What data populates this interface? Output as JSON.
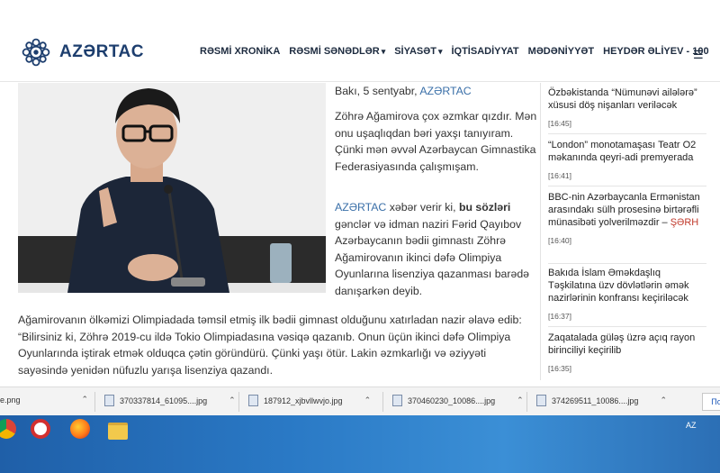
{
  "header": {
    "logo_text": "AZƏRTAC",
    "nav": [
      {
        "label": "RƏSMİ XRONİKA",
        "dropdown": false
      },
      {
        "label": "RƏSMİ SƏNƏDLƏR",
        "dropdown": true
      },
      {
        "label": "SİYASƏT",
        "dropdown": true
      },
      {
        "label": "İQTİSADİYYAT",
        "dropdown": false
      },
      {
        "label": "MƏDƏNİYYƏT",
        "dropdown": false
      },
      {
        "label": "HEYDƏR ƏLİYEV - 100",
        "dropdown": false
      }
    ],
    "menu_icon": "hamburger-icon"
  },
  "article": {
    "dateline_prefix": "Bakı, 5 sentyabr,",
    "dateline_brand": "AZƏRTAC",
    "p1": "Zöhrə Ağamirova çox əzmkar qızdır. Mən onu uşaqlıqdan bəri yaxşı tanıyıram. Çünki mən əvvəl Azərbaycan Gimnastika Federasiyasında çalışmışam.",
    "p2_brand": "AZƏRTAC",
    "p2_mid": " xəbər verir ki, ",
    "p2_bold": "bu sözləri",
    "p2_rest": " gənclər və idman naziri Fərid Qayıbov Azərbaycanın bədii gimnastı Zöhrə Ağamirovanın ikinci dəfə Olimpiya Oyunlarına lisenziya qazanması barədə danışarkən deyib.",
    "p3": "Ağamirovanın ölkəmizi Olimpiadada təmsil etmiş ilk bədii gimnast olduğunu xatırladan nazir əlavə edib: “Bilirsiniz ki, Zöhrə 2019-cu ildə Tokio Olimpiadasına vəsiqə qazanıb. Onun üçün ikinci dəfə Olimpiya Oyunlarında iştirak etmək olduqca çətin göründürü. Çünki yaşı ötür. Lakin əzmkarlığı və əziyyəti sayəsində yenidən nüfuzlu yarışa lisenziya qazandı."
  },
  "sidebar": {
    "items": [
      {
        "title": "Özbəkistanda “Nümunəvi ailələrə” xüsusi döş nişanları veriləcək",
        "time": "[16:45]"
      },
      {
        "title": "“London” monotamaşası Teatr O2 məkanında qeyri-adi premyerada",
        "time": "[16:41]"
      },
      {
        "title": "BBC-nin Azərbaycanla Ermənistan arasındakı sülh prosesinə birtərəfli münasibəti yolverilməzdir – ",
        "highlight": "ŞƏRH",
        "time": "[16:40]"
      },
      {
        "title": "Bakıda İslam Əməkdaşlıq Təşkilatına üzv dövlətlərin əmək nazirlərinin konfransı keçiriləcək",
        "time": "[16:37]"
      },
      {
        "title": "Zaqatalada güləş üzrə açıq rayon birinciliyi keçirilib",
        "time": "[16:35]"
      }
    ]
  },
  "downloads": {
    "items": [
      {
        "name": "e.png"
      },
      {
        "name": "370337814_61095....jpg"
      },
      {
        "name": "187912_xjbvllwvjo.jpg"
      },
      {
        "name": "370460230_10086....jpg"
      },
      {
        "name": "374269511_10086....jpg"
      }
    ],
    "show_all": "Пo"
  },
  "taskbar": {
    "tray_text": "AZ",
    "icons": [
      "chrome-icon",
      "opera-icon",
      "firefox-icon",
      "file-explorer-icon"
    ]
  },
  "colors": {
    "brand_blue": "#1d3e6e",
    "link_blue": "#3a6fa8",
    "highlight_red": "#c0392b",
    "taskbar": "#2a79c5"
  }
}
